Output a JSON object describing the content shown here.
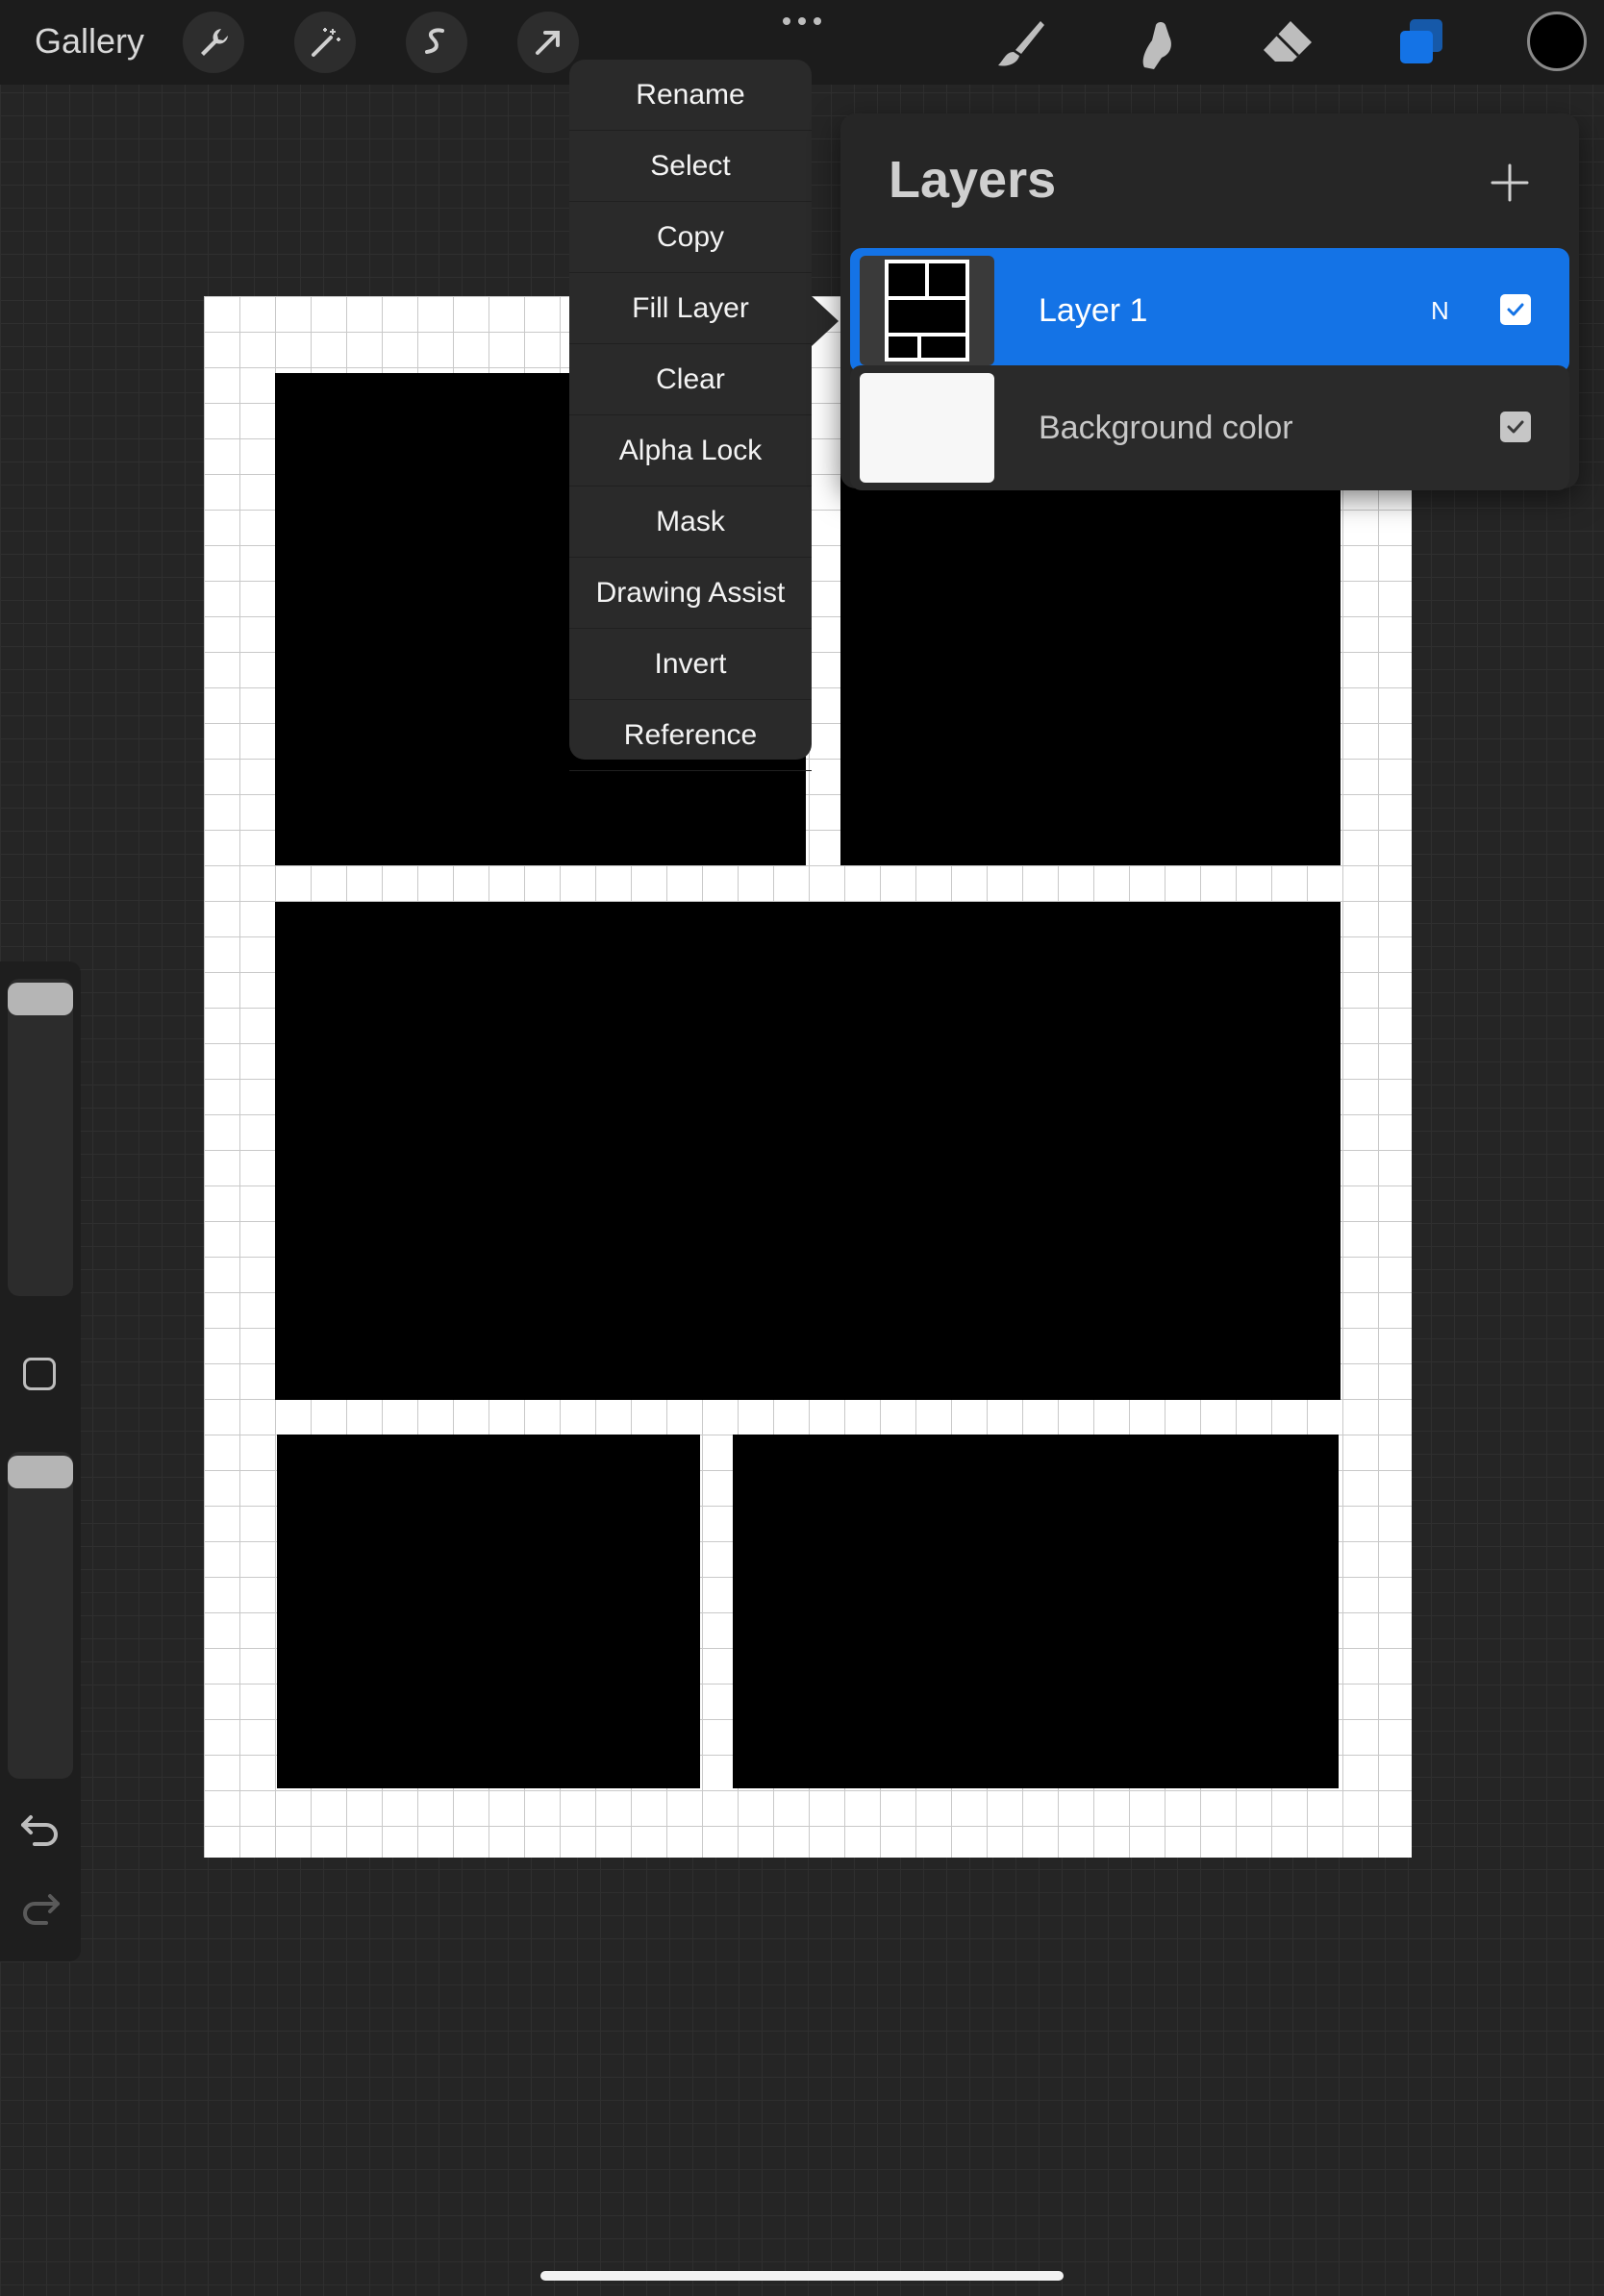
{
  "topbar": {
    "gallery_label": "Gallery",
    "left_tools": [
      "wrench-icon",
      "magic-wand-icon",
      "selection-icon",
      "transform-arrow-icon"
    ],
    "more_icon": "ellipsis-icon",
    "right_tools": [
      "brush-icon",
      "smudge-icon",
      "eraser-icon",
      "layers-icon"
    ],
    "current_color": "#000000",
    "accent_color": "#1473e6"
  },
  "context_menu": {
    "items": [
      "Rename",
      "Select",
      "Copy",
      "Fill Layer",
      "Clear",
      "Alpha Lock",
      "Mask",
      "Drawing Assist",
      "Invert",
      "Reference"
    ]
  },
  "layers_panel": {
    "title": "Layers",
    "add_icon": "plus-icon",
    "layers": [
      {
        "name": "Layer 1",
        "blend_mode": "N",
        "visible": true,
        "selected": true
      },
      {
        "name": "Background color",
        "visible": true,
        "selected": false
      }
    ]
  },
  "sidebar": {
    "size_slider_level": 1.0,
    "opacity_slider_level": 1.0,
    "tools": [
      "modify-square-icon",
      "undo-icon",
      "redo-icon"
    ]
  }
}
